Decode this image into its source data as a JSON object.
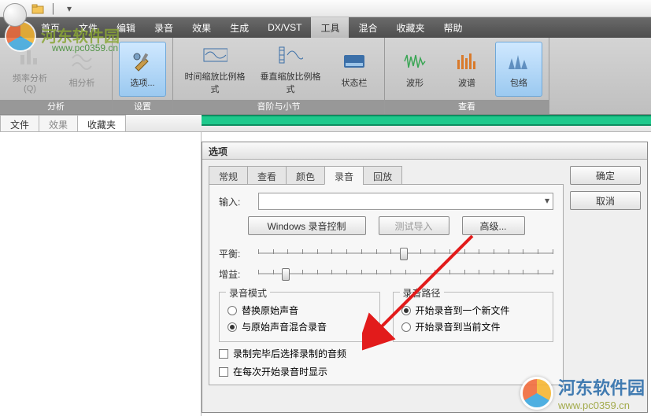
{
  "titlebar": {
    "folder_icon": "folder-icon",
    "dropdown_icon": "chevron-down-icon"
  },
  "menu": {
    "items": [
      "首页",
      "文件",
      "编辑",
      "录音",
      "效果",
      "生成",
      "DX/VST",
      "工具",
      "混合",
      "收藏夹",
      "帮助"
    ],
    "active_index": 7
  },
  "ribbon": {
    "groups": [
      {
        "label": "分析",
        "buttons": [
          {
            "label": "频率分析(Q)",
            "icon": "bars-icon"
          },
          {
            "label": "相分析",
            "icon": "wave-compare-icon"
          }
        ]
      },
      {
        "label": "设置",
        "buttons": [
          {
            "label": "选项...",
            "icon": "tools-icon",
            "selected": true
          }
        ]
      },
      {
        "label": "音阶与小节",
        "buttons": [
          {
            "label": "时间缩放比例格式",
            "icon": "h-scale-icon",
            "wide": true
          },
          {
            "label": "垂直缩放比例格式",
            "icon": "v-scale-icon",
            "wide": true
          },
          {
            "label": "状态栏",
            "icon": "statusbar-icon"
          }
        ]
      },
      {
        "label": "查看",
        "buttons": [
          {
            "label": "波形",
            "icon": "waveform-icon"
          },
          {
            "label": "波谱",
            "icon": "spectrum-icon"
          },
          {
            "label": "包络",
            "icon": "envelope-icon",
            "selected": true
          }
        ]
      }
    ]
  },
  "panel_tabs": {
    "items": [
      "文件",
      "效果",
      "收藏夹"
    ],
    "active_index": 2
  },
  "dialog": {
    "title": "选项",
    "tabs": [
      "常规",
      "查看",
      "颜色",
      "录音",
      "回放"
    ],
    "active_tab_index": 3,
    "ok": "确定",
    "cancel": "取消",
    "recording": {
      "input_label": "输入:",
      "input_value": "",
      "btn_win_rec": "Windows 录音控制",
      "btn_test_import": "测试导入",
      "btn_advanced": "高级...",
      "balance_label": "平衡:",
      "gain_label": "增益:",
      "mode_group": "录音模式",
      "mode_replace": "替换原始声音",
      "mode_mix": "与原始声音混合录音",
      "mode_selected": "mix",
      "path_group": "录音路径",
      "path_newfile": "开始录音到一个新文件",
      "path_curfile": "开始录音到当前文件",
      "path_selected": "newfile",
      "chk_select_after": "录制完毕后选择录制的音频",
      "chk_show_each": "在每次开始录音时显示"
    }
  },
  "watermark": {
    "name": "河东软件园",
    "url": "www.pc0359.cn"
  }
}
